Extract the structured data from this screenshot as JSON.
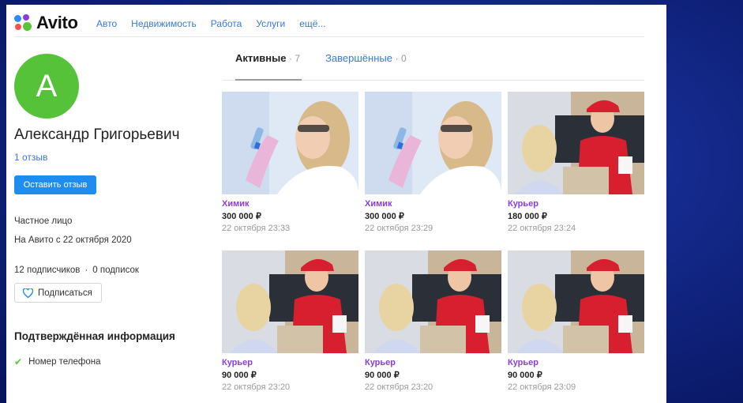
{
  "header": {
    "brand": "Avito",
    "nav": [
      "Авто",
      "Недвижимость",
      "Работа",
      "Услуги",
      "ещё..."
    ]
  },
  "profile": {
    "avatar_letter": "A",
    "name": "Александр Григорьевич",
    "reviews_link": "1 отзыв",
    "leave_review_label": "Оставить отзыв",
    "seller_type": "Частное лицо",
    "member_since": "На Авито с 22 октября 2020",
    "subscribers": "12 подписчиков",
    "separator": "·",
    "subscriptions": "0 подписок",
    "subscribe_label": "Подписаться",
    "verified_title": "Подтверждённая информация",
    "verified_items": [
      "Номер телефона"
    ]
  },
  "tabs": {
    "active_label": "Активные",
    "active_count": "· 7",
    "completed_label": "Завершённые",
    "completed_count": "· 0"
  },
  "listings": [
    {
      "title": "Химик",
      "price": "300 000 ₽",
      "date": "22 октября 23:33",
      "photo": "chemist-photo"
    },
    {
      "title": "Химик",
      "price": "300 000 ₽",
      "date": "22 октября 23:29",
      "photo": "chemist-photo"
    },
    {
      "title": "Курьер",
      "price": "180 000 ₽",
      "date": "22 октября 23:24",
      "photo": "courier-photo"
    },
    {
      "title": "Курьер",
      "price": "90 000 ₽",
      "date": "22 октября 23:20",
      "photo": "courier-photo"
    },
    {
      "title": "Курьер",
      "price": "90 000 ₽",
      "date": "22 октября 23:20",
      "photo": "courier-photo"
    },
    {
      "title": "Курьер",
      "price": "90 000 ₽",
      "date": "22 октября 23:09",
      "photo": "courier-photo"
    }
  ],
  "colors": {
    "accent_blue": "#1f8cf0",
    "link_blue": "#3c78d8",
    "title_purple": "#8b3ddb",
    "avatar_green": "#56c23a",
    "backdrop_blue": "#10237e"
  }
}
